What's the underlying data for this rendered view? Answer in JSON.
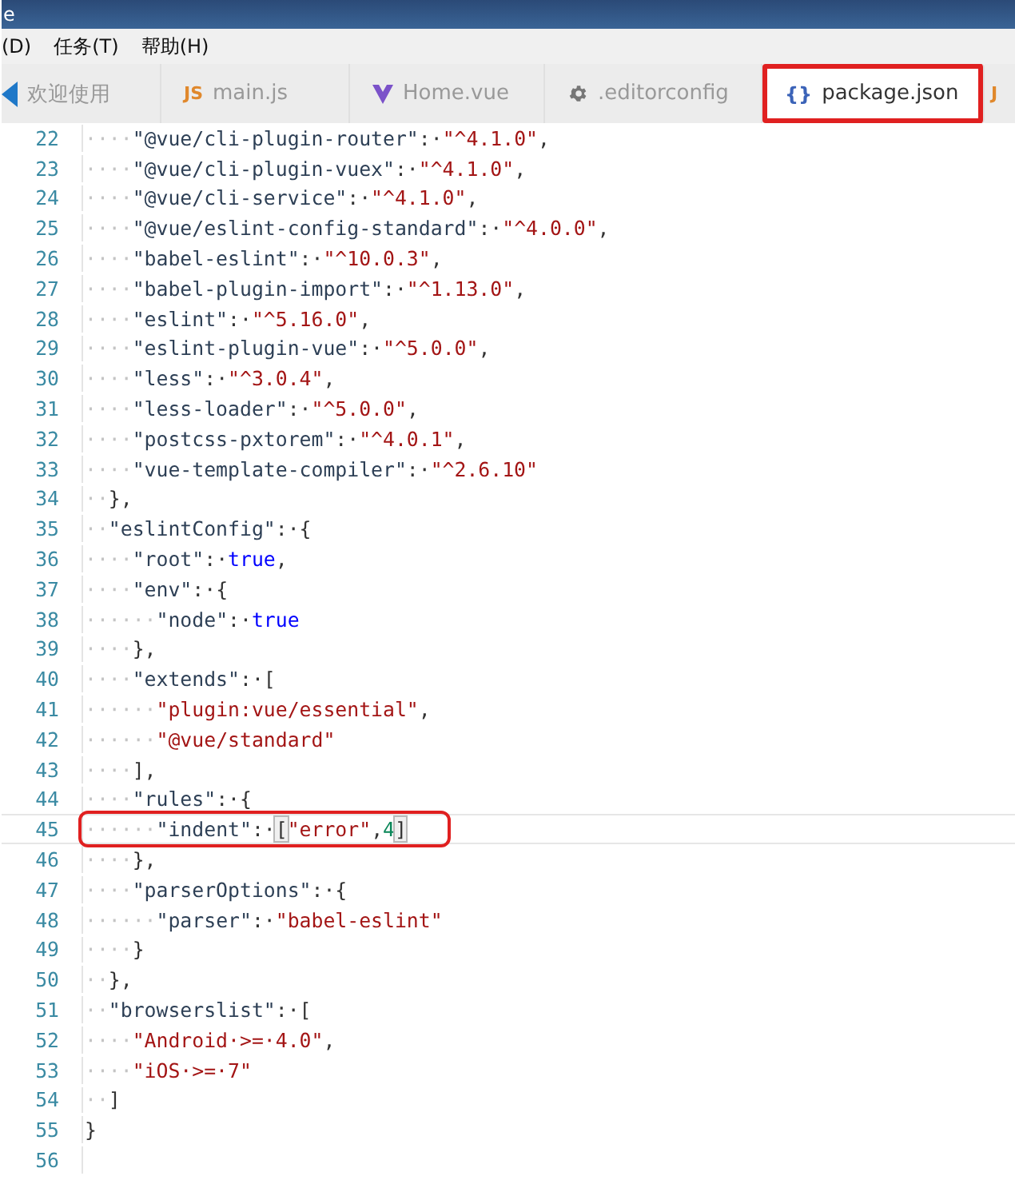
{
  "window": {
    "title": "e"
  },
  "menu": [
    {
      "label": "(D)"
    },
    {
      "label": "任务(T)"
    },
    {
      "label": "帮助(H)"
    }
  ],
  "tabs": [
    {
      "kind": "welcome",
      "label": "欢迎使用",
      "selected": false,
      "annotated": false
    },
    {
      "kind": "js",
      "icon_text": "JS",
      "label": "main.js",
      "selected": false,
      "annotated": false
    },
    {
      "kind": "vue",
      "label": "Home.vue",
      "selected": false,
      "annotated": false
    },
    {
      "kind": "config",
      "label": ".editorconfig",
      "selected": false,
      "annotated": false
    },
    {
      "kind": "json",
      "icon_text": "{}",
      "label": "package.json",
      "selected": true,
      "annotated": true
    },
    {
      "kind": "js",
      "icon_text": "J",
      "selected": false,
      "annotated": false
    }
  ],
  "editor": {
    "lines": [
      {
        "number": "22",
        "current": false,
        "tokens": [
          {
            "kind": "ws",
            "text": "····"
          },
          {
            "kind": "key",
            "text": "\"@vue/cli-plugin-router\""
          },
          {
            "kind": "punct",
            "text": ":·"
          },
          {
            "kind": "str",
            "text": "\"^4.1.0\""
          },
          {
            "kind": "punct",
            "text": ","
          }
        ]
      },
      {
        "number": "23",
        "current": false,
        "tokens": [
          {
            "kind": "ws",
            "text": "····"
          },
          {
            "kind": "key",
            "text": "\"@vue/cli-plugin-vuex\""
          },
          {
            "kind": "punct",
            "text": ":·"
          },
          {
            "kind": "str",
            "text": "\"^4.1.0\""
          },
          {
            "kind": "punct",
            "text": ","
          }
        ]
      },
      {
        "number": "24",
        "current": false,
        "tokens": [
          {
            "kind": "ws",
            "text": "····"
          },
          {
            "kind": "key",
            "text": "\"@vue/cli-service\""
          },
          {
            "kind": "punct",
            "text": ":·"
          },
          {
            "kind": "str",
            "text": "\"^4.1.0\""
          },
          {
            "kind": "punct",
            "text": ","
          }
        ]
      },
      {
        "number": "25",
        "current": false,
        "tokens": [
          {
            "kind": "ws",
            "text": "····"
          },
          {
            "kind": "key",
            "text": "\"@vue/eslint-config-standard\""
          },
          {
            "kind": "punct",
            "text": ":·"
          },
          {
            "kind": "str",
            "text": "\"^4.0.0\""
          },
          {
            "kind": "punct",
            "text": ","
          }
        ]
      },
      {
        "number": "26",
        "current": false,
        "tokens": [
          {
            "kind": "ws",
            "text": "····"
          },
          {
            "kind": "key",
            "text": "\"babel-eslint\""
          },
          {
            "kind": "punct",
            "text": ":·"
          },
          {
            "kind": "str",
            "text": "\"^10.0.3\""
          },
          {
            "kind": "punct",
            "text": ","
          }
        ]
      },
      {
        "number": "27",
        "current": false,
        "tokens": [
          {
            "kind": "ws",
            "text": "····"
          },
          {
            "kind": "key",
            "text": "\"babel-plugin-import\""
          },
          {
            "kind": "punct",
            "text": ":·"
          },
          {
            "kind": "str",
            "text": "\"^1.13.0\""
          },
          {
            "kind": "punct",
            "text": ","
          }
        ]
      },
      {
        "number": "28",
        "current": false,
        "tokens": [
          {
            "kind": "ws",
            "text": "····"
          },
          {
            "kind": "key",
            "text": "\"eslint\""
          },
          {
            "kind": "punct",
            "text": ":·"
          },
          {
            "kind": "str",
            "text": "\"^5.16.0\""
          },
          {
            "kind": "punct",
            "text": ","
          }
        ]
      },
      {
        "number": "29",
        "current": false,
        "tokens": [
          {
            "kind": "ws",
            "text": "····"
          },
          {
            "kind": "key",
            "text": "\"eslint-plugin-vue\""
          },
          {
            "kind": "punct",
            "text": ":·"
          },
          {
            "kind": "str",
            "text": "\"^5.0.0\""
          },
          {
            "kind": "punct",
            "text": ","
          }
        ]
      },
      {
        "number": "30",
        "current": false,
        "tokens": [
          {
            "kind": "ws",
            "text": "····"
          },
          {
            "kind": "key",
            "text": "\"less\""
          },
          {
            "kind": "punct",
            "text": ":·"
          },
          {
            "kind": "str",
            "text": "\"^3.0.4\""
          },
          {
            "kind": "punct",
            "text": ","
          }
        ]
      },
      {
        "number": "31",
        "current": false,
        "tokens": [
          {
            "kind": "ws",
            "text": "····"
          },
          {
            "kind": "key",
            "text": "\"less-loader\""
          },
          {
            "kind": "punct",
            "text": ":·"
          },
          {
            "kind": "str",
            "text": "\"^5.0.0\""
          },
          {
            "kind": "punct",
            "text": ","
          }
        ]
      },
      {
        "number": "32",
        "current": false,
        "tokens": [
          {
            "kind": "ws",
            "text": "····"
          },
          {
            "kind": "key",
            "text": "\"postcss-pxtorem\""
          },
          {
            "kind": "punct",
            "text": ":·"
          },
          {
            "kind": "str",
            "text": "\"^4.0.1\""
          },
          {
            "kind": "punct",
            "text": ","
          }
        ]
      },
      {
        "number": "33",
        "current": false,
        "tokens": [
          {
            "kind": "ws",
            "text": "····"
          },
          {
            "kind": "key",
            "text": "\"vue-template-compiler\""
          },
          {
            "kind": "punct",
            "text": ":·"
          },
          {
            "kind": "str",
            "text": "\"^2.6.10\""
          }
        ]
      },
      {
        "number": "34",
        "current": false,
        "tokens": [
          {
            "kind": "ws",
            "text": "··"
          },
          {
            "kind": "punct",
            "text": "},"
          }
        ]
      },
      {
        "number": "35",
        "current": false,
        "tokens": [
          {
            "kind": "ws",
            "text": "··"
          },
          {
            "kind": "key",
            "text": "\"eslintConfig\""
          },
          {
            "kind": "punct",
            "text": ":·{"
          }
        ]
      },
      {
        "number": "36",
        "current": false,
        "tokens": [
          {
            "kind": "ws",
            "text": "····"
          },
          {
            "kind": "key",
            "text": "\"root\""
          },
          {
            "kind": "punct",
            "text": ":·"
          },
          {
            "kind": "keyword",
            "text": "true"
          },
          {
            "kind": "punct",
            "text": ","
          }
        ]
      },
      {
        "number": "37",
        "current": false,
        "tokens": [
          {
            "kind": "ws",
            "text": "····"
          },
          {
            "kind": "key",
            "text": "\"env\""
          },
          {
            "kind": "punct",
            "text": ":·{"
          }
        ]
      },
      {
        "number": "38",
        "current": false,
        "tokens": [
          {
            "kind": "ws",
            "text": "······"
          },
          {
            "kind": "key",
            "text": "\"node\""
          },
          {
            "kind": "punct",
            "text": ":·"
          },
          {
            "kind": "keyword",
            "text": "true"
          }
        ]
      },
      {
        "number": "39",
        "current": false,
        "tokens": [
          {
            "kind": "ws",
            "text": "····"
          },
          {
            "kind": "punct",
            "text": "},"
          }
        ]
      },
      {
        "number": "40",
        "current": false,
        "tokens": [
          {
            "kind": "ws",
            "text": "····"
          },
          {
            "kind": "key",
            "text": "\"extends\""
          },
          {
            "kind": "punct",
            "text": ":·["
          }
        ]
      },
      {
        "number": "41",
        "current": false,
        "tokens": [
          {
            "kind": "ws",
            "text": "······"
          },
          {
            "kind": "str",
            "text": "\"plugin:vue/essential\""
          },
          {
            "kind": "punct",
            "text": ","
          }
        ]
      },
      {
        "number": "42",
        "current": false,
        "tokens": [
          {
            "kind": "ws",
            "text": "······"
          },
          {
            "kind": "str",
            "text": "\"@vue/standard\""
          }
        ]
      },
      {
        "number": "43",
        "current": false,
        "tokens": [
          {
            "kind": "ws",
            "text": "····"
          },
          {
            "kind": "punct",
            "text": "],"
          }
        ]
      },
      {
        "number": "44",
        "current": false,
        "tokens": [
          {
            "kind": "ws",
            "text": "····"
          },
          {
            "kind": "key",
            "text": "\"rules\""
          },
          {
            "kind": "punct",
            "text": ":·{"
          }
        ]
      },
      {
        "number": "45",
        "current": true,
        "annotated": true,
        "tokens": [
          {
            "kind": "ws",
            "text": "······"
          },
          {
            "kind": "key",
            "text": "\"indent\""
          },
          {
            "kind": "punct",
            "text": ":·"
          },
          {
            "kind": "bracket_match",
            "text": "["
          },
          {
            "kind": "str",
            "text": "\"error\""
          },
          {
            "kind": "punct",
            "text": ","
          },
          {
            "kind": "number",
            "text": "4"
          },
          {
            "kind": "bracket_match",
            "text": "]"
          }
        ]
      },
      {
        "number": "46",
        "current": false,
        "tokens": [
          {
            "kind": "ws",
            "text": "····"
          },
          {
            "kind": "punct",
            "text": "},"
          }
        ]
      },
      {
        "number": "47",
        "current": false,
        "tokens": [
          {
            "kind": "ws",
            "text": "····"
          },
          {
            "kind": "key",
            "text": "\"parserOptions\""
          },
          {
            "kind": "punct",
            "text": ":·{"
          }
        ]
      },
      {
        "number": "48",
        "current": false,
        "tokens": [
          {
            "kind": "ws",
            "text": "······"
          },
          {
            "kind": "key",
            "text": "\"parser\""
          },
          {
            "kind": "punct",
            "text": ":·"
          },
          {
            "kind": "str",
            "text": "\"babel-eslint\""
          }
        ]
      },
      {
        "number": "49",
        "current": false,
        "tokens": [
          {
            "kind": "ws",
            "text": "····"
          },
          {
            "kind": "punct",
            "text": "}"
          }
        ]
      },
      {
        "number": "50",
        "current": false,
        "tokens": [
          {
            "kind": "ws",
            "text": "··"
          },
          {
            "kind": "punct",
            "text": "},"
          }
        ]
      },
      {
        "number": "51",
        "current": false,
        "tokens": [
          {
            "kind": "ws",
            "text": "··"
          },
          {
            "kind": "key",
            "text": "\"browserslist\""
          },
          {
            "kind": "punct",
            "text": ":·["
          }
        ]
      },
      {
        "number": "52",
        "current": false,
        "tokens": [
          {
            "kind": "ws",
            "text": "····"
          },
          {
            "kind": "str",
            "text": "\"Android·>=·4.0\""
          },
          {
            "kind": "punct",
            "text": ","
          }
        ]
      },
      {
        "number": "53",
        "current": false,
        "tokens": [
          {
            "kind": "ws",
            "text": "····"
          },
          {
            "kind": "str",
            "text": "\"iOS·>=·7\""
          }
        ]
      },
      {
        "number": "54",
        "current": false,
        "tokens": [
          {
            "kind": "ws",
            "text": "··"
          },
          {
            "kind": "punct",
            "text": "]"
          }
        ]
      },
      {
        "number": "55",
        "current": false,
        "tokens": [
          {
            "kind": "punct",
            "text": "}"
          }
        ]
      },
      {
        "number": "56",
        "current": false
      }
    ]
  }
}
